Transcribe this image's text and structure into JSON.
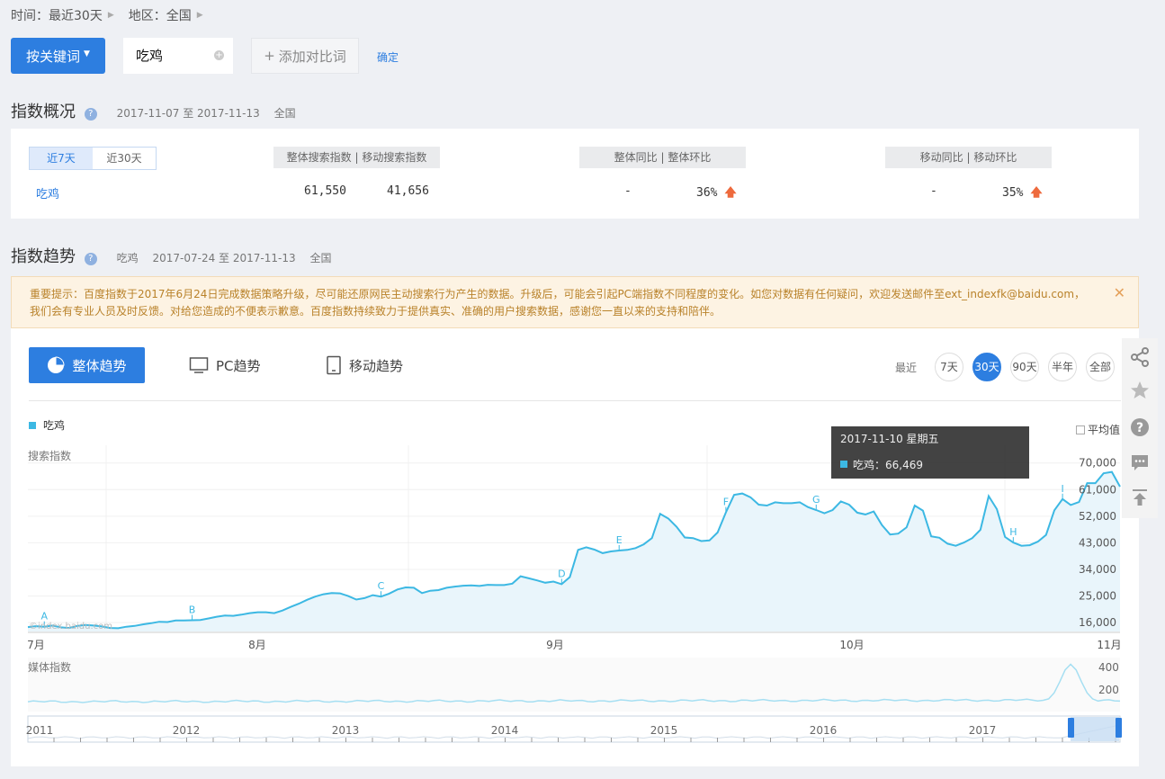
{
  "filter": {
    "time_label": "时间：最近30天",
    "region_label": "地区：全国"
  },
  "search": {
    "mode_button": "按关键词",
    "keyword": "吃鸡",
    "add_compare": "添加对比词",
    "confirm": "确定"
  },
  "overview": {
    "title": "指数概况",
    "date_range": "2017-11-07 至 2017-11-13",
    "region": "全国",
    "tabs": [
      "近7天",
      "近30天"
    ],
    "head_search": "整体搜索指数  |  移动搜索指数",
    "head_overall": "整体同比  |  整体环比",
    "head_mobile": "移动同比  |  移动环比",
    "keyword": "吃鸡",
    "overall_search": "61,550",
    "mobile_search": "41,656",
    "overall_yoy": "-",
    "overall_mom": "36%",
    "mobile_yoy": "-",
    "mobile_mom": "35%",
    "up_arrow": "🡅"
  },
  "trend": {
    "title": "指数趋势",
    "keyword": "吃鸡",
    "date_range": "2017-07-24 至 2017-11-13",
    "region": "全国",
    "notice": "重要提示：百度指数于2017年6月24日完成数据策略升级，尽可能还原网民主动搜索行为产生的数据。升级后，可能会引起PC端指数不同程度的变化。如您对数据有任何疑问，欢迎发送邮件至ext_indexfk@baidu.com，我们会有专业人员及时反馈。对给您造成的不便表示歉意。百度指数持续致力于提供真实、准确的用户搜索数据，感谢您一直以来的支持和陪伴。",
    "notice_close": "✕",
    "tab_overall": "整体趋势",
    "tab_pc": "PC趋势",
    "tab_mobile": "移动趋势",
    "range_prefix": "最近",
    "ranges": [
      "7天",
      "30天",
      "90天",
      "半年",
      "全部"
    ],
    "active_range": "30天",
    "legend": "吃鸡",
    "avg_label": "平均值",
    "tooltip_date": "2017-11-10 星期五",
    "tooltip_value": "吃鸡：66,469",
    "watermark": "©index.baidu.com",
    "accent": "#2d7ee0",
    "line_color": "#3cb8e3"
  },
  "chart_data": [
    {
      "type": "area",
      "ylabel": "搜索指数",
      "yticks": [
        "16,000",
        "25,000",
        "34,000",
        "43,000",
        "52,000",
        "61,000",
        "70,000"
      ],
      "ylim": [
        13000,
        76000
      ],
      "xticks": [
        "7月",
        "8月",
        "9月",
        "10月",
        "11月"
      ],
      "series": [
        {
          "name": "吃鸡",
          "values": [
            14500,
            14800,
            14600,
            15000,
            14400,
            14200,
            14900,
            15200,
            15000,
            14700,
            14200,
            14100,
            14600,
            14900,
            15400,
            15800,
            16300,
            16200,
            16700,
            16700,
            16800,
            16900,
            17400,
            18000,
            18400,
            18300,
            18700,
            19200,
            19500,
            19500,
            19200,
            20100,
            21300,
            22400,
            23700,
            24800,
            25600,
            26000,
            25900,
            25000,
            23800,
            24300,
            25300,
            24800,
            25800,
            27200,
            27900,
            27800,
            26000,
            26800,
            27000,
            27800,
            28200,
            28500,
            28600,
            28400,
            28800,
            28700,
            28700,
            29200,
            31700,
            31000,
            30300,
            29500,
            29900,
            29000,
            31400,
            40600,
            41500,
            40700,
            39500,
            40100,
            40400,
            40600,
            41200,
            42500,
            44600,
            52800,
            51200,
            48400,
            44800,
            44600,
            43600,
            43800,
            46500,
            53300,
            59200,
            59700,
            58400,
            55900,
            55600,
            56700,
            56400,
            56400,
            56700,
            55100,
            54100,
            53000,
            54100,
            57000,
            55900,
            53200,
            52600,
            53600,
            49000,
            45800,
            46100,
            48200,
            55600,
            53900,
            45200,
            44700,
            42700,
            42000,
            43100,
            44600,
            47400,
            58800,
            54400,
            45000,
            43100,
            42000,
            42200,
            43400,
            45700,
            54000,
            57800,
            55800,
            56800,
            63200,
            63200,
            66500,
            67000,
            62000
          ]
        }
      ],
      "annotations": [
        "A",
        "B",
        "C",
        "D",
        "E",
        "F",
        "G",
        "H",
        "I"
      ]
    },
    {
      "type": "area",
      "ylabel": "媒体指数",
      "yticks": [
        "200",
        "400"
      ],
      "ylim": [
        0,
        520
      ],
      "overview_years": [
        "2011",
        "2012",
        "2013",
        "2014",
        "2015",
        "2016",
        "2017"
      ]
    }
  ]
}
